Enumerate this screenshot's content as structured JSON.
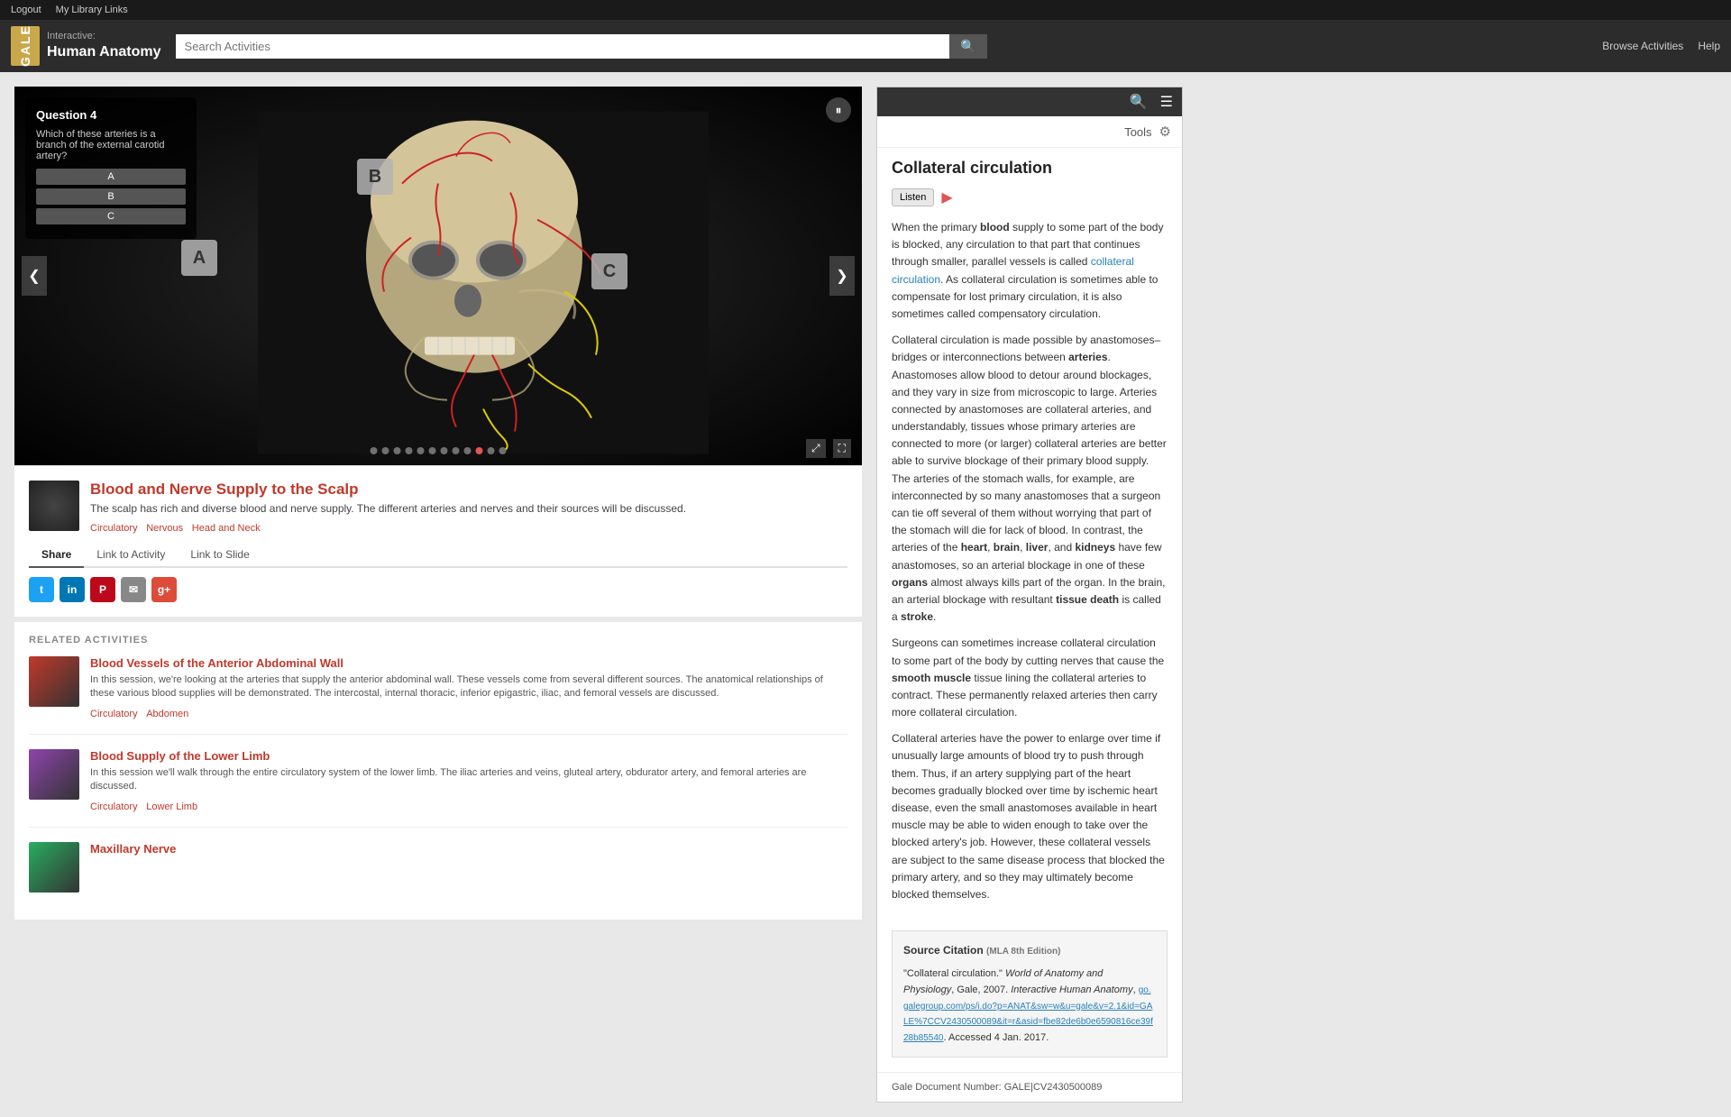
{
  "topbar": {
    "logout_label": "Logout",
    "my_library_label": "My Library Links"
  },
  "header": {
    "logo_gale": "GALE",
    "logo_interactive": "Interactive:",
    "logo_title": "Human Anatomy",
    "search_placeholder": "Search Activities",
    "browse_label": "Browse Activities",
    "help_label": "Help"
  },
  "viewer": {
    "quiz_title": "Question 4",
    "quiz_question": "Which of these arteries is a branch of the external carotid artery?",
    "option_a": "A",
    "option_b": "B",
    "option_c": "C",
    "label_a": "A",
    "label_b": "B",
    "label_c": "C",
    "nav_left": "❮",
    "nav_right": "❯",
    "dots": [
      1,
      2,
      3,
      4,
      5,
      6,
      7,
      8,
      9,
      10,
      11,
      12
    ],
    "active_dot": 10
  },
  "activity": {
    "title": "Blood and Nerve Supply to the Scalp",
    "description": "The scalp has rich and diverse blood and nerve supply. The different arteries and nerves and their sources will be discussed.",
    "tags": [
      "Circulatory",
      "Nervous",
      "Head and Neck"
    ],
    "share_tab": "Share",
    "link_activity_tab": "Link to Activity",
    "link_slide_tab": "Link to Slide"
  },
  "related": {
    "section_label": "RELATED ACTIVITIES",
    "items": [
      {
        "name": "Blood Vessels of the Anterior Abdominal Wall",
        "description": "In this session, we're looking at the arteries that supply the anterior abdominal wall. These vessels come from several different sources. The anatomical relationships of these various blood supplies will be demonstrated. The intercostal, internal thoracic, inferior epigastric, iliac, and femoral vessels are discussed.",
        "tags": [
          "Circulatory",
          "Abdomen"
        ]
      },
      {
        "name": "Blood Supply of the Lower Limb",
        "description": "In this session we'll walk through the entire circulatory system of the lower limb. The iliac arteries and veins, gluteal artery, obdurator artery, and femoral arteries are discussed.",
        "tags": [
          "Circulatory",
          "Lower Limb"
        ]
      },
      {
        "name": "Maxillary Nerve",
        "description": "",
        "tags": []
      }
    ]
  },
  "right_panel": {
    "tools_label": "Tools",
    "article_title": "Collateral circulation",
    "listen_label": "Listen",
    "body_paragraphs": [
      "When the primary blood supply to some part of the body is blocked, any circulation to that part that continues through smaller, parallel vessels is called collateral circulation. As collateral circulation is sometimes able to compensate for lost primary circulation, it is also sometimes called compensatory circulation.",
      "Collateral circulation is made possible by anastomoses–bridges or interconnections between arteries. Anastomoses allow blood to detour around blockages, and they vary in size from microscopic to large. Arteries connected by anastomoses are collateral arteries, and understandably, tissues whose primary arteries are connected to more (or larger) collateral arteries are better able to survive blockage of their primary blood supply. The arteries of the stomach walls, for example, are interconnected by so many anastomoses that a surgeon can tie off several of them without worrying that part of the stomach will die for lack of blood. In contrast, the arteries of the heart, brain, liver, and kidneys have few anastomoses, so an arterial blockage in one of these organs almost always kills part of the organ. In the brain, an arterial blockage with resultant tissue death is called a stroke.",
      "Surgeons can sometimes increase collateral circulation to some part of the body by cutting nerves that cause the smooth muscle tissue lining the collateral arteries to contract. These permanently relaxed arteries then carry more collateral circulation.",
      "Collateral arteries have the power to enlarge over time if unusually large amounts of blood try to push through them. Thus, if an artery supplying part of the heart becomes gradually blocked over time by ischemic heart disease, even the small anastomoses available in heart muscle may be able to widen enough to take over the blocked artery's job. However, these collateral vessels are subject to the same disease process that blocked the primary artery, and so they may ultimately become blocked themselves."
    ],
    "source_citation_title": "Source Citation",
    "source_citation_edition": "(MLA 8th Edition)",
    "source_citation_text": "\"Collateral circulation.\" World of Anatomy and Physiology, Gale, 2007. Interactive Human Anatomy, go.galegroup.com/ps/i.do?p=ANAT&sw=w&u=gale&v=2.1&id=GALE%7CCV2430500089&it=r&asid=fbe82de6b0e6590816ce39f28b85540. Accessed 4 Jan. 2017.",
    "gale_doc_label": "Gale Document Number:",
    "gale_doc_number": "GALE|CV2430500089"
  }
}
